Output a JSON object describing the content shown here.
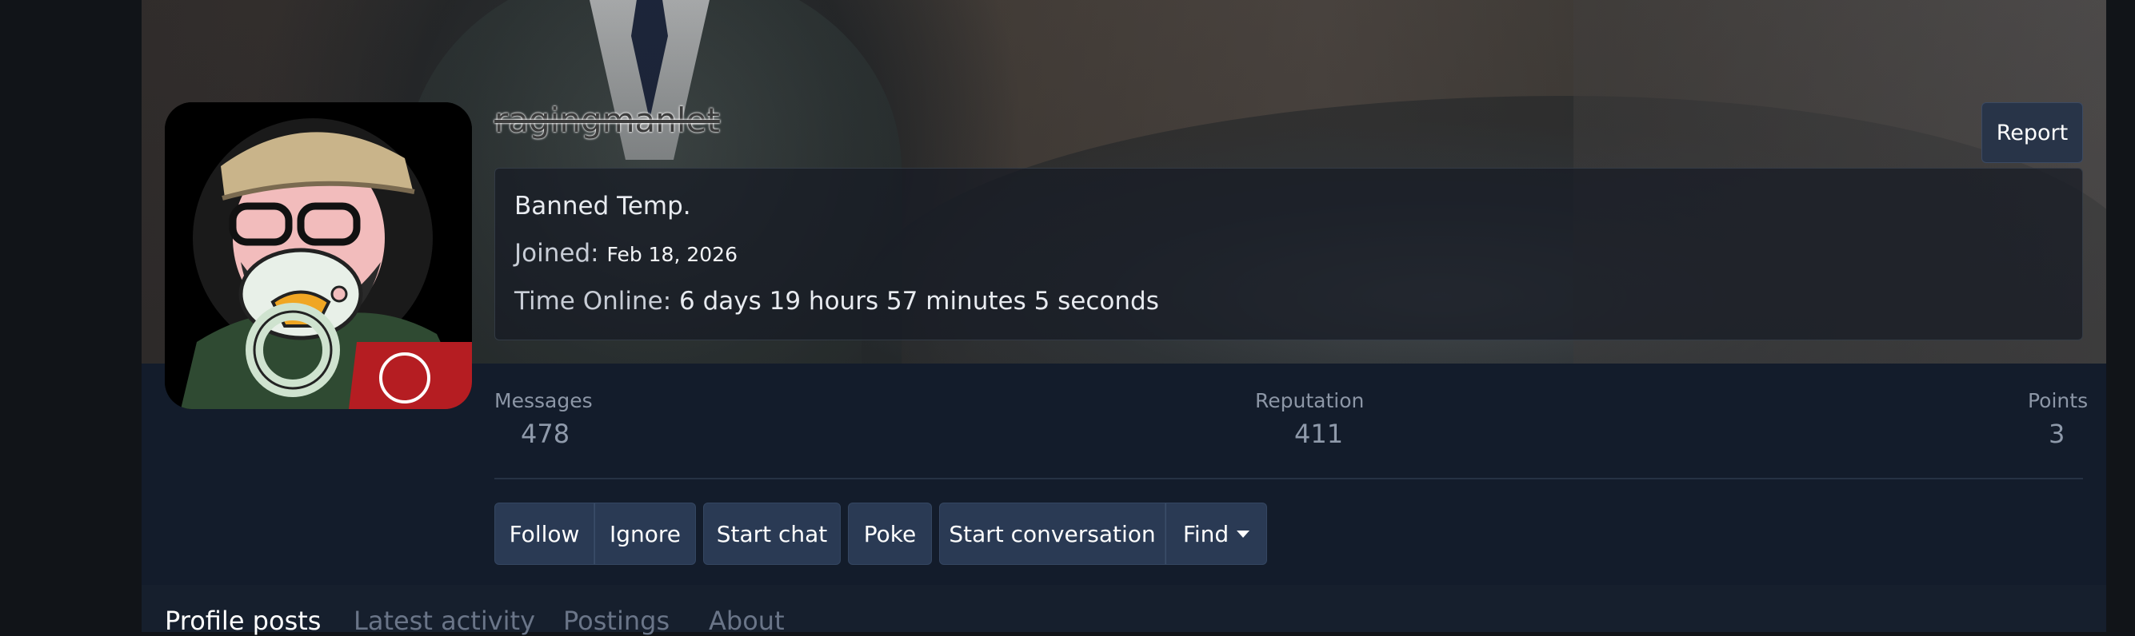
{
  "profile": {
    "username": "ragingmanlet",
    "report_label": "Report",
    "status": "Banned Temp.",
    "joined_label": "Joined:",
    "joined_value": "Feb 18, 2026",
    "time_online_label": "Time Online:",
    "time_online_value": "6 days 19 hours 57 minutes 5 seconds"
  },
  "stats": [
    {
      "label": "Messages",
      "value": "478"
    },
    {
      "label": "Reputation",
      "value": "411"
    },
    {
      "label": "Points",
      "value": "3"
    }
  ],
  "actions": {
    "follow": "Follow",
    "ignore": "Ignore",
    "start_chat": "Start chat",
    "poke": "Poke",
    "start_conversation": "Start conversation",
    "find": "Find"
  },
  "tabs": [
    "Profile posts",
    "Latest activity",
    "Postings",
    "About"
  ],
  "colors": {
    "page_bg": "#131c2b",
    "button_bg": "#2a3a54",
    "accent_text": "#ffffff"
  }
}
